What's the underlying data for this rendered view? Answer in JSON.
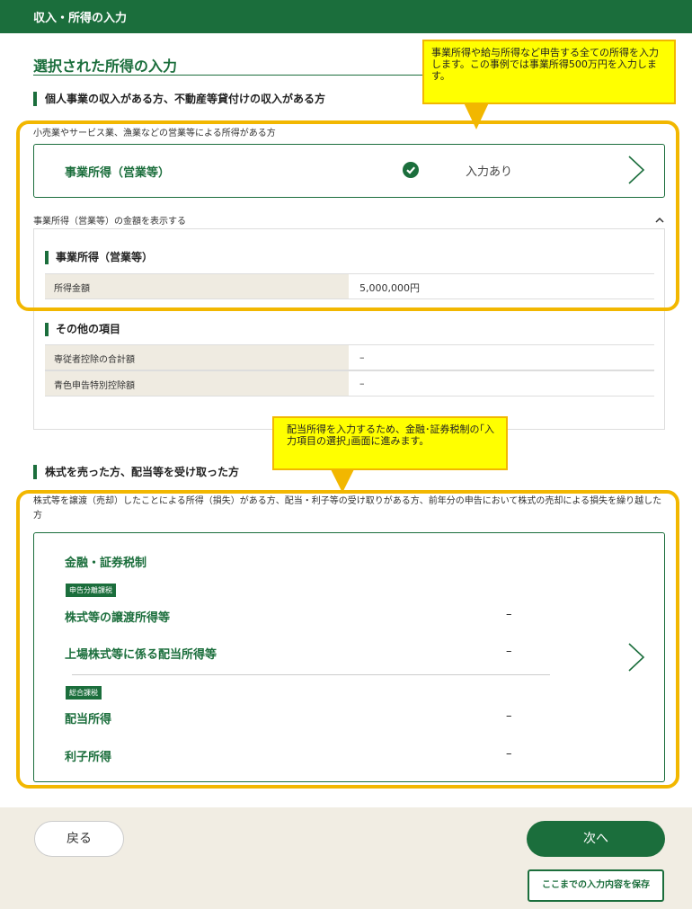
{
  "header": {
    "title": "収入・所得の入力"
  },
  "page": {
    "title": "選択された所得の入力"
  },
  "section1": {
    "heading": "個人事業の収入がある方、不動産等貸付けの収入がある方",
    "desc": "小売業やサービス業、漁業などの営業等による所得がある方",
    "card": {
      "title": "事業所得（営業等）",
      "status": "入力あり",
      "status_icon": "check-circle-icon"
    },
    "toggle_label": "事業所得（営業等）の金額を表示する",
    "detail": {
      "group1_title": "事業所得（営業等）",
      "rows1": [
        {
          "key": "所得金額",
          "value": "5,000,000円"
        }
      ],
      "group2_title": "その他の項目",
      "rows2": [
        {
          "key": "専従者控除の合計額",
          "value": "–"
        },
        {
          "key": "青色申告特別控除額",
          "value": "–"
        }
      ]
    }
  },
  "section2": {
    "heading": "株式を売った方、配当等を受け取った方",
    "desc": "株式等を譲渡（売却）したことによる所得（損失）がある方、配当・利子等の受け取りがある方、前年分の申告において株式の売却による損失を繰り越した方",
    "card": {
      "title": "金融・証券税制",
      "tag1": "申告分離課税",
      "items1": [
        {
          "label": "株式等の譲渡所得等",
          "value": "–"
        },
        {
          "label": "上場株式等に係る配当所得等",
          "value": "–"
        }
      ],
      "tag2": "総合課税",
      "items2": [
        {
          "label": "配当所得",
          "value": "–"
        },
        {
          "label": "利子所得",
          "value": "–"
        }
      ]
    }
  },
  "callouts": {
    "callout1": "事業所得や給与所得など申告する全ての所得を入力します。この事例では事業所得500万円を入力します。",
    "callout2": "配当所得を入力するため、金融･証券税制の｢入力項目の選択｣画面に進みます。"
  },
  "footer": {
    "back_label": "戻る",
    "next_label": "次へ",
    "save_label": "ここまでの入力内容を保存"
  },
  "colors": {
    "brand_green": "#1b6e3c",
    "callout_yellow": "#ffff00",
    "highlight_orange": "#f2b700",
    "footer_bg": "#f1ede3"
  }
}
